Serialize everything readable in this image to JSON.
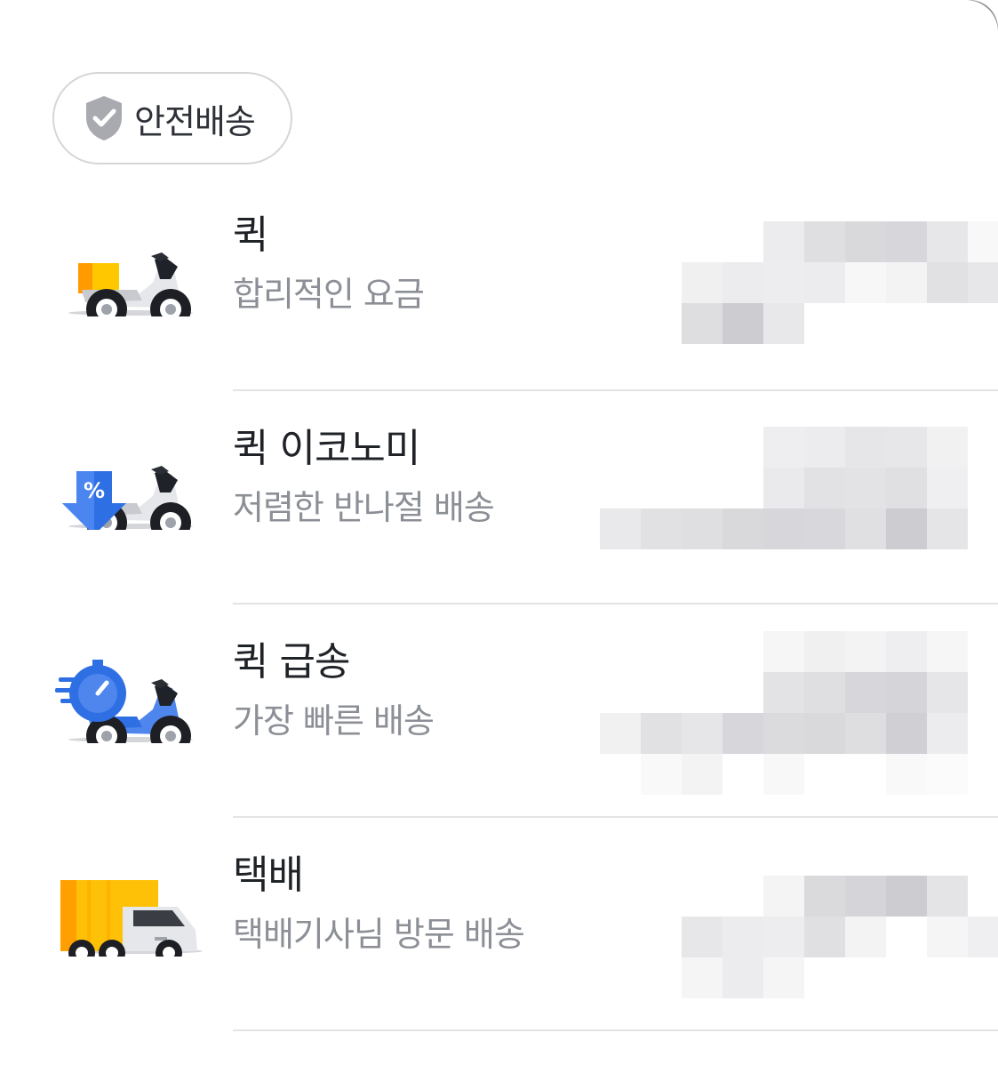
{
  "sheet": {
    "chip": {
      "icon": "shield-check-icon",
      "label": "안전배송"
    },
    "options": [
      {
        "title": "퀵",
        "subtitle": "합리적인 요금",
        "icon": "scooter-box-icon"
      },
      {
        "title": "퀵 이코노미",
        "subtitle": "저렴한 반나절 배송",
        "icon": "scooter-discount-icon"
      },
      {
        "title": "퀵 급송",
        "subtitle": "가장 빠른 배송",
        "icon": "scooter-fast-icon"
      },
      {
        "title": "택배",
        "subtitle": "택배기사님 방문 배송",
        "icon": "delivery-truck-icon"
      }
    ],
    "colors": {
      "title": "#1f2227",
      "subtitle": "#8c8f96",
      "divider": "#e4e4e7",
      "chip_border": "#d6d6d9",
      "box_yellow": "#ffc107",
      "discount_blue": "#2f6fe4"
    }
  }
}
